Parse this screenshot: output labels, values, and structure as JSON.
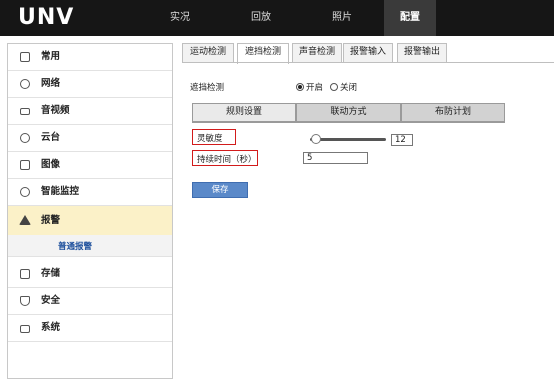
{
  "app": {
    "logo": "UNV"
  },
  "topnav": {
    "items": [
      "实况",
      "回放",
      "照片",
      "配置"
    ],
    "active": "配置"
  },
  "sidebar": {
    "items": [
      {
        "label": "常用",
        "icon": "home-icon"
      },
      {
        "label": "网络",
        "icon": "network-icon"
      },
      {
        "label": "音视频",
        "icon": "video-icon"
      },
      {
        "label": "云台",
        "icon": "ptz-icon"
      },
      {
        "label": "图像",
        "icon": "image-icon"
      },
      {
        "label": "智能监控",
        "icon": "smart-monitor-icon"
      },
      {
        "label": "报警",
        "icon": "alarm-icon"
      },
      {
        "label": "存储",
        "icon": "storage-icon"
      },
      {
        "label": "安全",
        "icon": "shield-icon"
      },
      {
        "label": "系统",
        "icon": "system-icon"
      }
    ],
    "selected": "报警",
    "subitem": "普通报警"
  },
  "tabs": {
    "items": [
      "运动检测",
      "遮挡检测",
      "声音检测",
      "报警输入",
      "报警输出"
    ],
    "active": "遮挡检测"
  },
  "form": {
    "enable_label": "遮挡检测",
    "radio_on": "开启",
    "radio_off": "关闭",
    "radio_selected": "开启"
  },
  "subtabs": {
    "items": [
      "规则设置",
      "联动方式",
      "布防计划"
    ],
    "active": "规则设置"
  },
  "fields": {
    "sensitivity_label": "灵敏度",
    "sensitivity_value": "12",
    "duration_label": "持续时间（秒）",
    "duration_value": "5"
  },
  "buttons": {
    "save": "保存"
  },
  "colors": {
    "accent": "#5a89c9",
    "highlight": "#d21b1b",
    "selected_bg": "#fbf1c8",
    "topbar": "#161616"
  }
}
